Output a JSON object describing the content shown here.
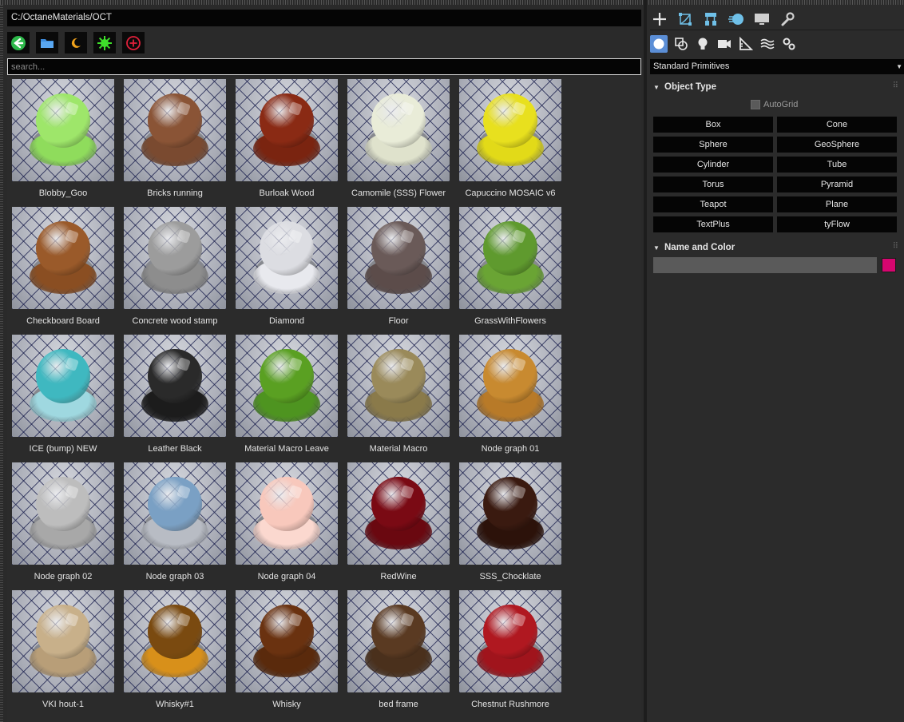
{
  "browser": {
    "path": "C:/OctaneMaterials/OCT",
    "search_placeholder": "search...",
    "toolbar": [
      {
        "name": "back-button",
        "icon": "back-arrow-icon"
      },
      {
        "name": "open-folder-button",
        "icon": "folder-icon"
      },
      {
        "name": "night-mode-button",
        "icon": "moon-icon"
      },
      {
        "name": "day-mode-button",
        "icon": "sun-icon"
      },
      {
        "name": "add-button",
        "icon": "plus-circle-icon"
      }
    ],
    "materials": [
      {
        "label": "Blobby_Goo",
        "ball": "#9ee66a",
        "base": "#8fdc5c"
      },
      {
        "label": "Bricks running",
        "ball": "#8a5436",
        "base": "#7a4a30"
      },
      {
        "label": "Burloak Wood",
        "ball": "#8a2a14",
        "base": "#7a2410"
      },
      {
        "label": "Camomile (SSS) Flower",
        "ball": "#e9ecd8",
        "base": "#dfe2cc"
      },
      {
        "label": "Capuccino MOSAIC v6",
        "ball": "#e8e01e",
        "base": "#e2da18"
      },
      {
        "label": "Checkboard Board",
        "ball": "#9a5a2a",
        "base": "#8a4e22"
      },
      {
        "label": "Concrete wood stamp",
        "ball": "#9c9c9c",
        "base": "#8d8d8d"
      },
      {
        "label": "Diamond",
        "ball": "#dcdde2",
        "base": "#e8e9ee"
      },
      {
        "label": "Floor",
        "ball": "#6a5a58",
        "base": "#5c4c4a"
      },
      {
        "label": "GrassWithFlowers",
        "ball": "#5f9a2e",
        "base": "#6aa434"
      },
      {
        "label": "ICE (bump) NEW",
        "ball": "#3fb8c0",
        "base": "#9fd8e0"
      },
      {
        "label": "Leather Black",
        "ball": "#2a2a2a",
        "base": "#1c1c1c"
      },
      {
        "label": "Material Macro Leave",
        "ball": "#5aa022",
        "base": "#4e9420"
      },
      {
        "label": "Material Macro",
        "ball": "#9a8a5a",
        "base": "#8a7a4a"
      },
      {
        "label": "Node graph 01",
        "ball": "#c88a30",
        "base": "#b87a28"
      },
      {
        "label": "Node graph 02",
        "ball": "#bdbdbd",
        "base": "#a8a8a8"
      },
      {
        "label": "Node graph 03",
        "ball": "#7aa0c4",
        "base": "#b8bcc4"
      },
      {
        "label": "Node graph 04",
        "ball": "#f8c8bc",
        "base": "#fbd8cf"
      },
      {
        "label": "RedWine",
        "ball": "#7a0a14",
        "base": "#6a0810"
      },
      {
        "label": "SSS_Chocklate",
        "ball": "#3a1a10",
        "base": "#2c120a"
      },
      {
        "label": "VKI hout-1",
        "ball": "#c8b08a",
        "base": "#b89e78"
      },
      {
        "label": "Whisky#1",
        "ball": "#7a4a10",
        "base": "#d8901a"
      },
      {
        "label": "Whisky",
        "ball": "#6a3210",
        "base": "#5a2a0c"
      },
      {
        "label": "bed frame",
        "ball": "#5a3a22",
        "base": "#4a301c"
      },
      {
        "label": "Chestnut Rushmore",
        "ball": "#b01820",
        "base": "#a0141c"
      }
    ]
  },
  "panel": {
    "top_tabs": [
      "create-icon",
      "modify-icon",
      "hierarchy-icon",
      "motion-icon",
      "display-icon",
      "utilities-icon"
    ],
    "sub_tabs": [
      "geometry-icon",
      "shapes-icon",
      "lights-icon",
      "cameras-icon",
      "helpers-icon",
      "spacewarps-icon",
      "systems-icon"
    ],
    "primitive_type": "Standard Primitives",
    "object_type_title": "Object Type",
    "autogrid_label": "AutoGrid",
    "object_buttons": [
      "Box",
      "Cone",
      "Sphere",
      "GeoSphere",
      "Cylinder",
      "Tube",
      "Torus",
      "Pyramid",
      "Teapot",
      "Plane",
      "TextPlus",
      "tyFlow"
    ],
    "name_color_title": "Name and Color",
    "object_color": "#d6066f"
  }
}
